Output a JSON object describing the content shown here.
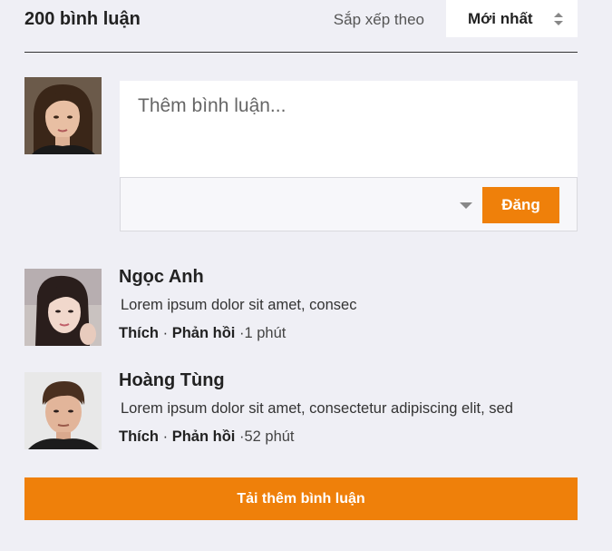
{
  "header": {
    "count_label": "200 bình luận",
    "sort_label": "Sắp xếp theo",
    "sort_value": "Mới nhất"
  },
  "composer": {
    "placeholder": "Thêm bình luận...",
    "post_label": "Đăng"
  },
  "comments": [
    {
      "name": "Ngọc Anh",
      "text": "Lorem ipsum dolor sit amet, consec",
      "like_label": "Thích",
      "reply_label": "Phản hồi",
      "time": "1 phút"
    },
    {
      "name": "Hoàng Tùng",
      "text": "Lorem ipsum dolor sit amet, consectetur adipiscing elit, sed",
      "like_label": "Thích",
      "reply_label": "Phản hồi",
      "time": "52 phút"
    }
  ],
  "load_more_label": "Tải thêm bình luận",
  "colors": {
    "accent": "#ef800a",
    "background": "#efeff5"
  }
}
